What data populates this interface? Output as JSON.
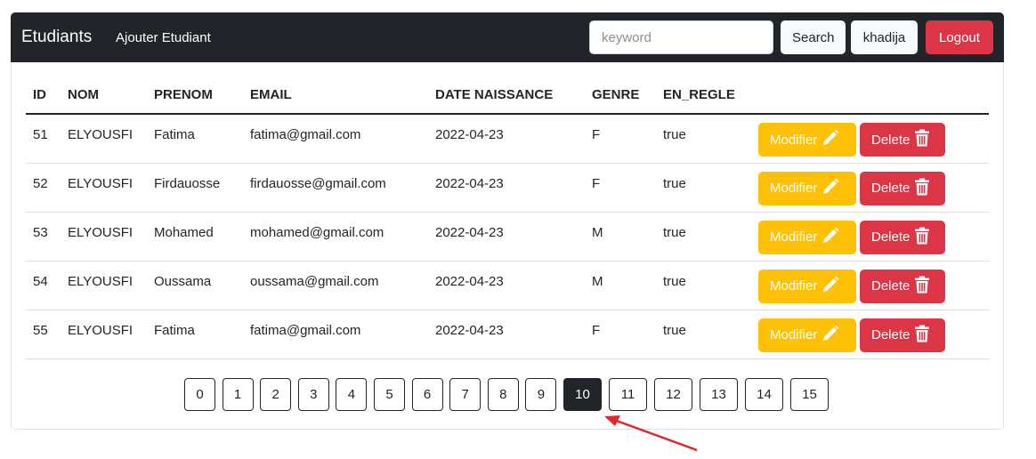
{
  "navbar": {
    "brand": "Etudiants",
    "add_link": "Ajouter Etudiant",
    "search_placeholder": "keyword",
    "search_value": "",
    "search_label": "Search",
    "user_label": "khadija",
    "logout_label": "Logout"
  },
  "table": {
    "headers": [
      "ID",
      "NOM",
      "PRENOM",
      "EMAIL",
      "DATE NAISSANCE",
      "GENRE",
      "EN_REGLE"
    ],
    "rows": [
      {
        "id": "51",
        "nom": "ELYOUSFI",
        "prenom": "Fatima",
        "email": "fatima@gmail.com",
        "date": "2022-04-23",
        "genre": "F",
        "en_regle": "true"
      },
      {
        "id": "52",
        "nom": "ELYOUSFI",
        "prenom": "Firdauosse",
        "email": "firdauosse@gmail.com",
        "date": "2022-04-23",
        "genre": "F",
        "en_regle": "true"
      },
      {
        "id": "53",
        "nom": "ELYOUSFI",
        "prenom": "Mohamed",
        "email": "mohamed@gmail.com",
        "date": "2022-04-23",
        "genre": "M",
        "en_regle": "true"
      },
      {
        "id": "54",
        "nom": "ELYOUSFI",
        "prenom": "Oussama",
        "email": "oussama@gmail.com",
        "date": "2022-04-23",
        "genre": "M",
        "en_regle": "true"
      },
      {
        "id": "55",
        "nom": "ELYOUSFI",
        "prenom": "Fatima",
        "email": "fatima@gmail.com",
        "date": "2022-04-23",
        "genre": "F",
        "en_regle": "true"
      }
    ],
    "modify_label": "Modifier",
    "delete_label": "Delete"
  },
  "pagination": {
    "pages": [
      "0",
      "1",
      "2",
      "3",
      "4",
      "5",
      "6",
      "7",
      "8",
      "9",
      "10",
      "11",
      "12",
      "13",
      "14",
      "15"
    ],
    "current": "10"
  },
  "colors": {
    "navbar": "#212529",
    "warning": "#ffc107",
    "danger": "#dc3545",
    "annotation_arrow": "#e0262d"
  },
  "icons": {
    "modify": "pencil-icon",
    "delete": "trash-icon"
  }
}
